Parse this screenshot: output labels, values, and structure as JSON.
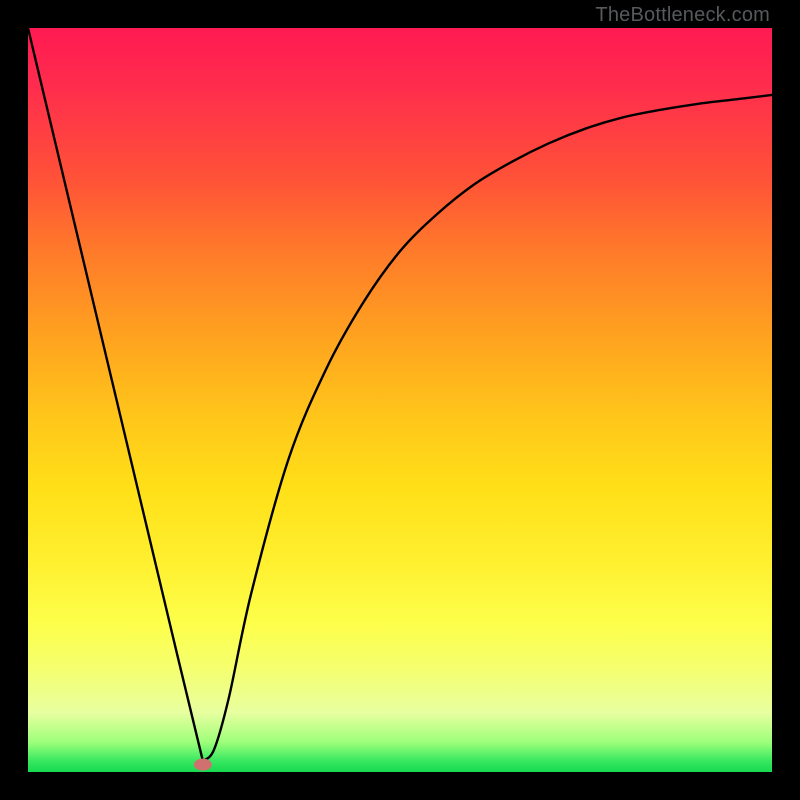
{
  "attribution": "TheBottleneck.com",
  "chart_data": {
    "type": "line",
    "title": "",
    "xlabel": "",
    "ylabel": "",
    "xlim": [
      0,
      100
    ],
    "ylim": [
      0,
      100
    ],
    "series": [
      {
        "name": "curve",
        "x": [
          0,
          5,
          10,
          15,
          20,
          23.5,
          25,
          27,
          30,
          35,
          40,
          45,
          50,
          55,
          60,
          65,
          70,
          75,
          80,
          85,
          90,
          95,
          100
        ],
        "y": [
          100,
          79,
          58,
          37,
          16,
          1.5,
          3,
          10,
          24,
          42,
          54,
          63,
          70,
          75,
          79,
          82,
          84.5,
          86.5,
          88,
          89,
          89.8,
          90.4,
          91
        ]
      }
    ],
    "marker": {
      "x": 23.5,
      "y": 1.0,
      "color": "#d0716f"
    },
    "gradient_stops": [
      {
        "pos": 0,
        "color": "#ff1a52"
      },
      {
        "pos": 100,
        "color": "#17d94f"
      }
    ]
  }
}
